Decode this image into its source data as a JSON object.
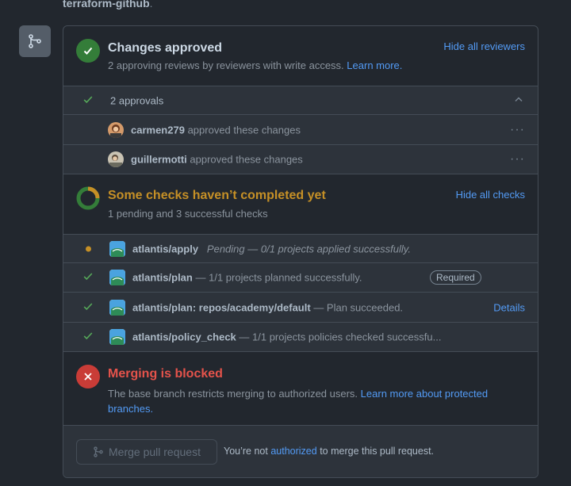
{
  "repo": {
    "name": "terraform-github",
    "trailing": "."
  },
  "approved": {
    "title": "Changes approved",
    "subtitle": "2 approving reviews by reviewers with write access.",
    "learn_more": "Learn more.",
    "hide_reviewers": "Hide all reviewers",
    "color": "#347d39"
  },
  "approvals": {
    "summary": "2 approvals",
    "reviewers": [
      {
        "name": "carmen279",
        "action": "approved these changes"
      },
      {
        "name": "guillermotti",
        "action": "approved these changes"
      }
    ]
  },
  "checks_summary": {
    "title": "Some checks haven’t completed yet",
    "subtitle": "1 pending and 3 successful checks",
    "hide_checks": "Hide all checks",
    "title_color": "#c69026"
  },
  "checks": [
    {
      "name": "atlantis/apply",
      "desc": "Pending — 0/1 projects applied successfully.",
      "status": "pending"
    },
    {
      "name": "atlantis/plan",
      "desc": "— 1/1 projects planned successfully.",
      "status": "success",
      "badge": "Required"
    },
    {
      "name": "atlantis/plan: repos/academy/default",
      "desc": "— Plan succeeded.",
      "status": "success",
      "link": "Details"
    },
    {
      "name": "atlantis/policy_check",
      "desc": "— 1/1 projects policies checked successfu...",
      "status": "success"
    }
  ],
  "blocked": {
    "title": "Merging is blocked",
    "text": "The base branch restricts merging to authorized users.",
    "link_line1": "Learn more about protected",
    "link_line2": "branches.",
    "color": "#e5534b"
  },
  "merge": {
    "button": "Merge pull request",
    "note_prefix": "You’re not",
    "note_link": "authorized",
    "note_suffix": "to merge this pull request."
  }
}
